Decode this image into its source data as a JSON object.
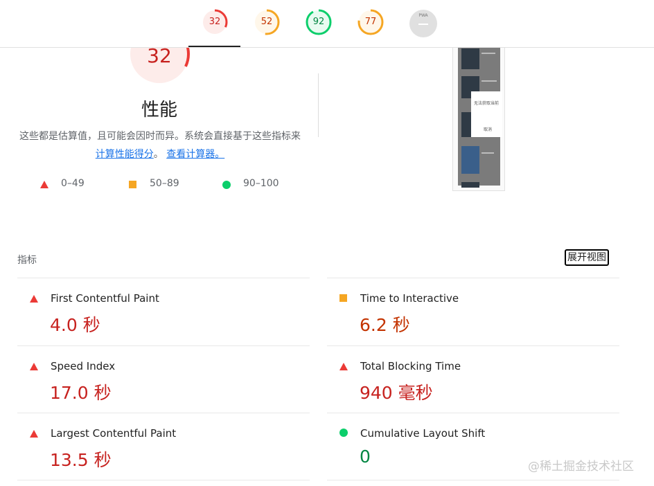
{
  "header": {
    "gauges": [
      {
        "id": "performance",
        "score": "32",
        "color": "#eb3a36",
        "fill": 0.32
      },
      {
        "id": "accessibility",
        "score": "52",
        "color": "#f5a623",
        "fill": 0.52
      },
      {
        "id": "best-practices",
        "score": "92",
        "color": "#0cce6b",
        "fill": 0.92
      },
      {
        "id": "seo",
        "score": "77",
        "color": "#f5a623",
        "fill": 0.77
      }
    ],
    "pwa_label": "PWA"
  },
  "performance": {
    "score": "32",
    "score_fill": 0.32,
    "title": "性能",
    "desc_part1": "这些都是估算值，且可能会因时而异。系统会直接基于这些指标来",
    "desc_link1": "计算性能得分",
    "desc_part2": "。 ",
    "desc_link2": "查看计算器。",
    "legend": [
      {
        "shape": "triangle",
        "label": "0–49",
        "color": "#eb3a36"
      },
      {
        "shape": "square",
        "label": "50–89",
        "color": "#f5a623"
      },
      {
        "shape": "circle",
        "label": "90–100",
        "color": "#0cce6b"
      }
    ]
  },
  "thumbnail": {
    "dialog_text": "无法获取当前",
    "dialog_close": "取消"
  },
  "metrics": {
    "label": "指标",
    "expand_label": "展开视图",
    "items": [
      {
        "name": "First Contentful Paint",
        "value": "4.0 秒",
        "rating": "fail"
      },
      {
        "name": "Time to Interactive",
        "value": "6.2 秒",
        "rating": "average"
      },
      {
        "name": "Speed Index",
        "value": "17.0 秒",
        "rating": "fail"
      },
      {
        "name": "Total Blocking Time",
        "value": "940 毫秒",
        "rating": "fail"
      },
      {
        "name": "Largest Contentful Paint",
        "value": "13.5 秒",
        "rating": "fail"
      },
      {
        "name": "Cumulative Layout Shift",
        "value": "0",
        "rating": "pass"
      }
    ]
  },
  "watermark": "@稀土掘金技术社区",
  "colors": {
    "fail": "#eb3a36",
    "average": "#f5a623",
    "pass": "#0cce6b",
    "fail_text": "#c7221f",
    "average_text": "#c33300",
    "pass_text": "#018642",
    "link": "#1a73e8"
  }
}
